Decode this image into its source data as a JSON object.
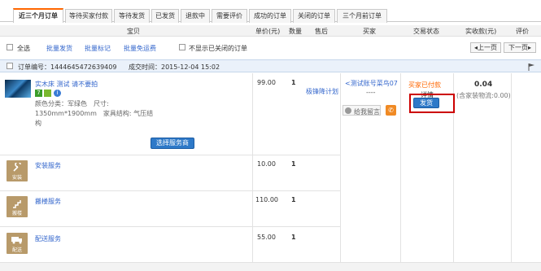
{
  "tabs": [
    {
      "label": "近三个月订单"
    },
    {
      "label": "等待买家付款"
    },
    {
      "label": "等待发货"
    },
    {
      "label": "已发货"
    },
    {
      "label": "退款中"
    },
    {
      "label": "需要评价"
    },
    {
      "label": "成功的订单"
    },
    {
      "label": "关闭的订单"
    },
    {
      "label": "三个月前订单"
    }
  ],
  "columns": {
    "item": "宝贝",
    "price": "单价(元)",
    "qty": "数量",
    "after_sale": "售后",
    "buyer": "买家",
    "status": "交易状态",
    "received": "实收款(元)",
    "rate": "评价"
  },
  "toolbar": {
    "select_all": "全选",
    "batch_ship": "批量发货",
    "batch_mark": "批量标记",
    "batch_free_ship": "批量免运费",
    "hide_closed": "不显示已关闭的订单",
    "prev_page": "◂上一页",
    "next_page": "下一页▸"
  },
  "order": {
    "number_label": "订单编号：1444645472639409",
    "time_label": "成交时间：2015-12-04 15:02",
    "product": {
      "title": "实木床 测试 请不要拍",
      "attrs1": "颜色分类：军绿色　尺寸:",
      "attrs2": "1350mm*1900mm　家具结构: 气压结",
      "attrs3": "构",
      "price": "99.00",
      "qty": "1",
      "plan": "极锋降计划",
      "badge_num": "7"
    },
    "buyer": {
      "name": "<测试账号菜鸟07",
      "dashes": "----",
      "message": "给我留言"
    },
    "status": {
      "text": "买家已付款",
      "detail": "详情",
      "ship_button": "发货"
    },
    "received": {
      "amount": "0.04",
      "note": "(含家装物流:0.00)"
    },
    "select_service_button": "选择服务商",
    "services": [
      {
        "name": "安装服务",
        "icon_label": "安装",
        "price": "10.00",
        "qty": "1",
        "icon": "wrench-icon"
      },
      {
        "name": "搬楼服务",
        "icon_label": "搬楼",
        "price": "110.00",
        "qty": "1",
        "icon": "stairs-icon"
      },
      {
        "name": "配送服务",
        "icon_label": "配送",
        "price": "55.00",
        "qty": "1",
        "icon": "truck-icon"
      }
    ]
  },
  "colors": {
    "accent_orange": "#f60",
    "link_blue": "#3366cc",
    "highlight_red": "#cc0000"
  }
}
